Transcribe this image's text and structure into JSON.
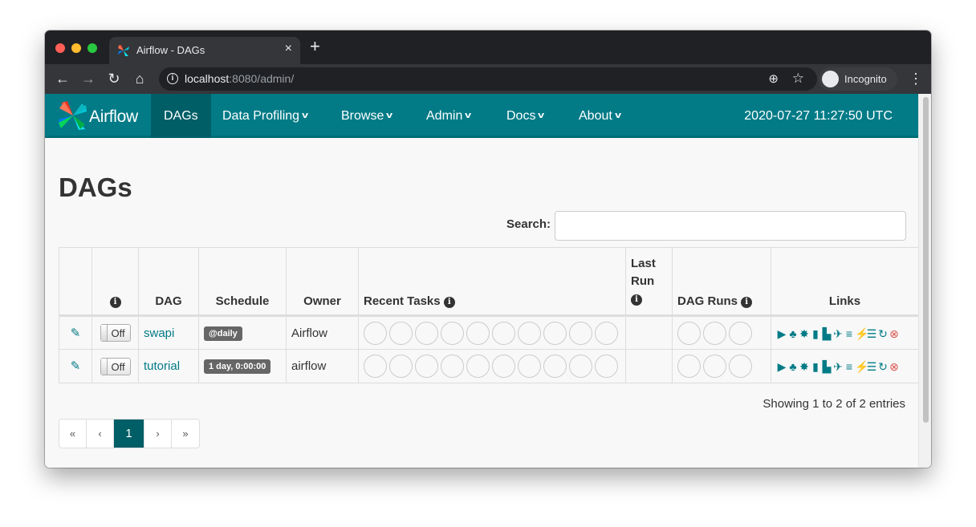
{
  "browser": {
    "tab_title": "Airflow - DAGs",
    "tab_close": "×",
    "new_tab": "+",
    "url_host": "localhost",
    "url_rest": ":8080/admin/",
    "incognito_label": "Incognito"
  },
  "navbar": {
    "brand": "Airflow",
    "items": [
      {
        "label": "DAGs",
        "active": true
      },
      {
        "label": "Data Profiling",
        "active": false
      },
      {
        "label": "Browse",
        "active": false
      },
      {
        "label": "Admin",
        "active": false
      },
      {
        "label": "Docs",
        "active": false
      },
      {
        "label": "About",
        "active": false
      }
    ],
    "clock": "2020-07-27 11:27:50 UTC"
  },
  "page": {
    "title": "DAGs",
    "search_label": "Search:",
    "search_value": ""
  },
  "table": {
    "headers": {
      "dag": "DAG",
      "schedule": "Schedule",
      "owner": "Owner",
      "recent_tasks": "Recent Tasks",
      "last_run_1": "Last",
      "last_run_2": "Run",
      "dag_runs": "DAG Runs",
      "links": "Links"
    },
    "rows": [
      {
        "toggle": "Off",
        "dag": "swapi",
        "schedule": "@daily",
        "owner": "Airflow"
      },
      {
        "toggle": "Off",
        "dag": "tutorial",
        "schedule": "1 day, 0:00:00",
        "owner": "airflow"
      }
    ]
  },
  "footer": {
    "entries": "Showing 1 to 2 of 2 entries",
    "pager": [
      "«",
      "‹",
      "1",
      "›",
      "»"
    ]
  },
  "colors": {
    "navbar": "#027b87",
    "active_nav": "#005e66",
    "link": "#017b86",
    "danger": "#d9534f"
  }
}
